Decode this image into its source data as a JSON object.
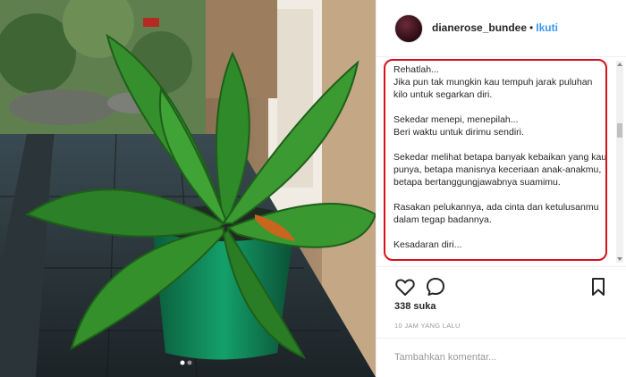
{
  "post": {
    "username": "dianerose_bundee",
    "separator": "•",
    "follow_label": "Ikuti",
    "caption": "Rehatlah...\nJika pun tak mungkin kau tempuh jarak puluhan kilo untuk segarkan diri.\n\nSekedar menepi, menepilah...\nBeri waktu untuk dirimu sendiri.\n\nSekedar melihat betapa banyak kebaikan yang kau punya, betapa manisnya keceriaan anak-anakmu, betapa bertanggungjawabnya suamimu.\n\nRasakan pelukannya, ada cinta dan ketulusanmu dalam tegap badannya.\n\nKesadaran diri...",
    "likes": "338 suka",
    "timestamp": "10 JAM YANG LALU",
    "comment_placeholder": "Tambahkan komentar..."
  },
  "icons": {
    "like": "heart-outline-icon",
    "comment": "speech-bubble-icon",
    "bookmark": "bookmark-icon"
  },
  "colors": {
    "follow": "#3897f0",
    "annotation": "#d7101a",
    "text": "#262626",
    "muted": "#999999"
  }
}
